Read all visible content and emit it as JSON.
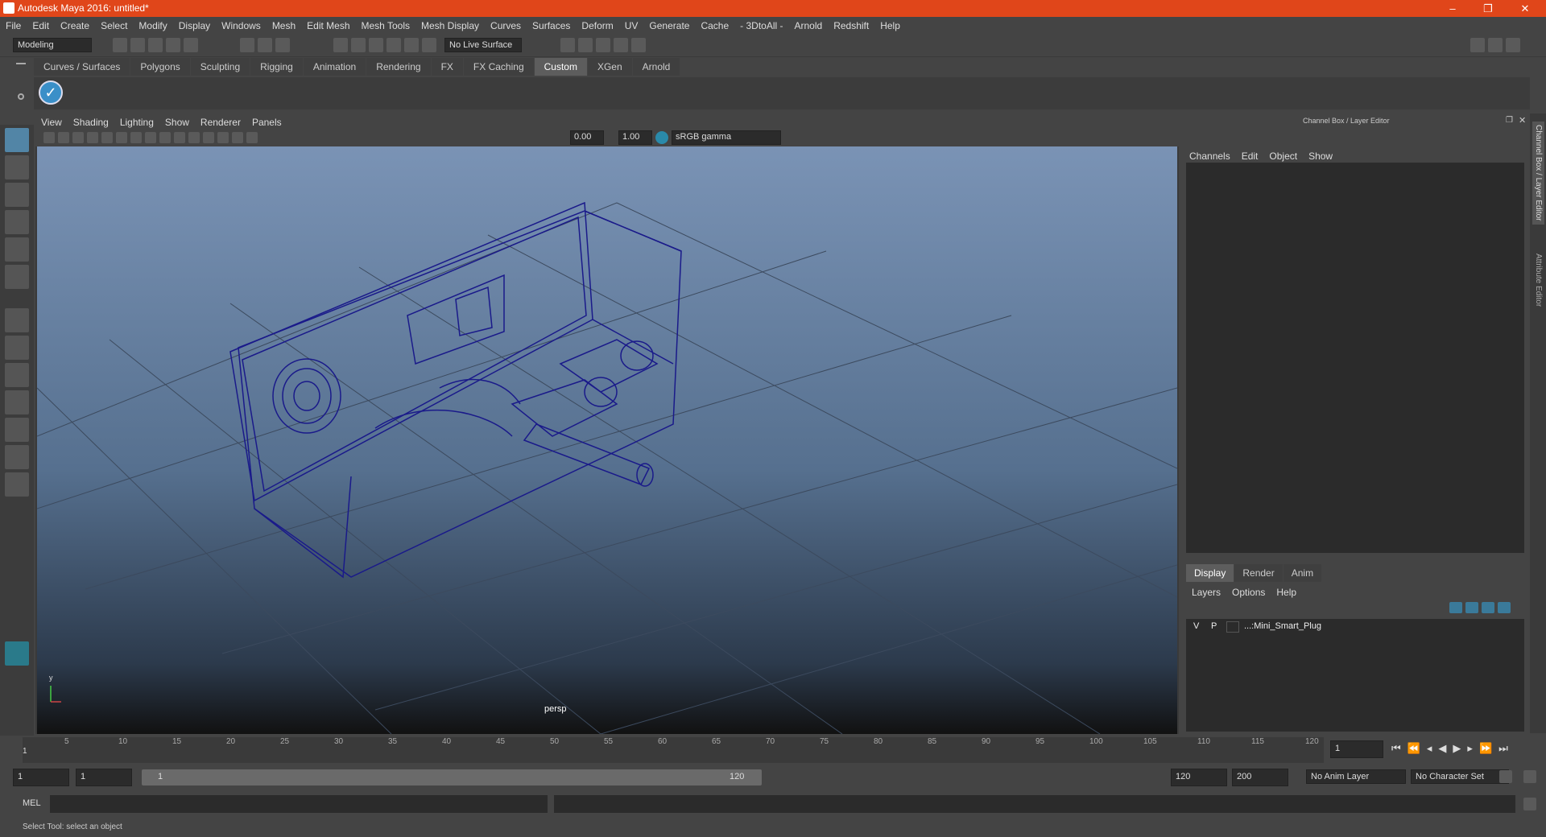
{
  "window": {
    "title": "Autodesk Maya 2016: untitled*",
    "controls": [
      "–",
      "❐",
      "✕"
    ]
  },
  "menubar": [
    "File",
    "Edit",
    "Create",
    "Select",
    "Modify",
    "Display",
    "Windows",
    "Mesh",
    "Edit Mesh",
    "Mesh Tools",
    "Mesh Display",
    "Curves",
    "Surfaces",
    "Deform",
    "UV",
    "Generate",
    "Cache",
    "- 3DtoAll -",
    "Arnold",
    "Redshift",
    "Help"
  ],
  "statusline": {
    "mode": "Modeling",
    "live_surface": "No Live Surface"
  },
  "shelf": {
    "tabs": [
      "Curves / Surfaces",
      "Polygons",
      "Sculpting",
      "Rigging",
      "Animation",
      "Rendering",
      "FX",
      "FX Caching",
      "Custom",
      "XGen",
      "Arnold"
    ],
    "active": "Custom"
  },
  "viewport": {
    "menu": [
      "View",
      "Shading",
      "Lighting",
      "Show",
      "Renderer",
      "Panels"
    ],
    "exposure": "0.00",
    "gamma": "1.00",
    "color_space": "sRGB gamma",
    "camera_label": "persp",
    "wire_color": "#1a1a8a"
  },
  "channelbox": {
    "title": "Channel Box / Layer Editor",
    "menu": [
      "Channels",
      "Edit",
      "Object",
      "Show"
    ],
    "layer_tabs": [
      "Display",
      "Render",
      "Anim"
    ],
    "active_layer_tab": "Display",
    "layer_menu": [
      "Layers",
      "Options",
      "Help"
    ],
    "layer": {
      "v": "V",
      "p": "P",
      "name": "...:Mini_Smart_Plug"
    }
  },
  "sidetabs": [
    "Channel Box / Layer Editor",
    "Attribute Editor"
  ],
  "timeline": {
    "ticks": [
      "5",
      "10",
      "15",
      "20",
      "25",
      "30",
      "35",
      "40",
      "45",
      "50",
      "55",
      "60",
      "65",
      "70",
      "75",
      "80",
      "85",
      "90",
      "95",
      "100",
      "105",
      "110",
      "115",
      "120"
    ],
    "current_frame": "1",
    "current_field": "1"
  },
  "range": {
    "start": "1",
    "start2": "1",
    "slider_start": "1",
    "slider_end": "120",
    "end": "120",
    "end2": "200",
    "anim_layer": "No Anim Layer",
    "char_set": "No Character Set"
  },
  "cmd": {
    "label": "MEL"
  },
  "help": {
    "text": "Select Tool: select an object"
  }
}
